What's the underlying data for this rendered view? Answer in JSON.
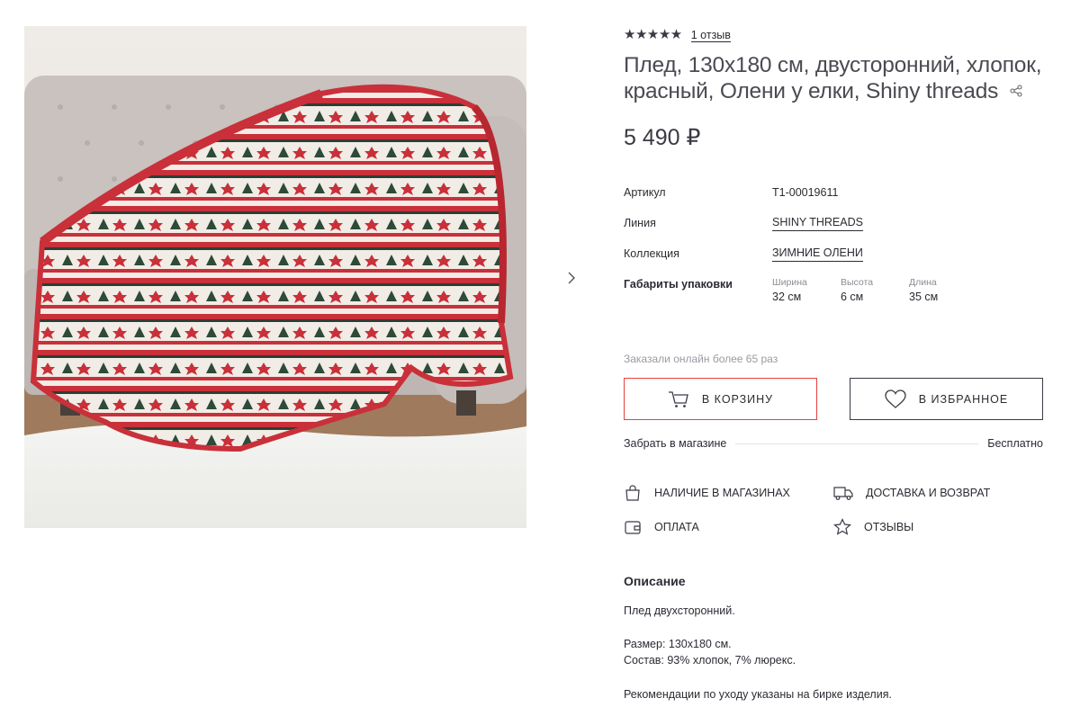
{
  "colors": {
    "accent": "#e8403a",
    "text": "#2b2b33",
    "muted": "#9a9aa2"
  },
  "rating": {
    "stars": "★★★★★",
    "value": 5,
    "reviews_label": "1 отзыв"
  },
  "product": {
    "title": "Плед, 130x180 см, двусторонний, хлопок, красный, Олени у елки, Shiny threads",
    "price": "5 490 ₽"
  },
  "specs": {
    "article_label": "Артикул",
    "article_value": "T1-00019611",
    "line_label": "Линия",
    "line_value": "SHINY THREADS",
    "collection_label": "Коллекция",
    "collection_value": "ЗИМНИЕ ОЛЕНИ",
    "package_label": "Габариты упаковки",
    "width_label": "Ширина",
    "width_value": "32 см",
    "height_label": "Высота",
    "height_value": "6 см",
    "length_label": "Длина",
    "length_value": "35 см"
  },
  "ordered_text": "Заказали онлайн более 65 раз",
  "buttons": {
    "cart": "В КОРЗИНУ",
    "favorite": "В ИЗБРАННОЕ"
  },
  "pickup": {
    "label": "Забрать в магазине",
    "value": "Бесплатно"
  },
  "links": {
    "stores": "НАЛИЧИЕ В МАГАЗИНАХ",
    "delivery": "ДОСТАВКА И ВОЗВРАТ",
    "payment": "ОПЛАТА",
    "reviews": "ОТЗЫВЫ"
  },
  "icons": [
    "chevron-right-icon",
    "share-icon",
    "cart-icon",
    "heart-icon",
    "shopping-bag-icon",
    "truck-icon",
    "wallet-icon",
    "star-icon"
  ],
  "description": {
    "title": "Описание",
    "line1": "Плед двухсторонний.",
    "line2": "Размер: 130x180 см.",
    "line3": "Состав: 93% хлопок, 7% люрекс.",
    "line4": "Рекомендации по уходу указаны на бирке изделия."
  }
}
